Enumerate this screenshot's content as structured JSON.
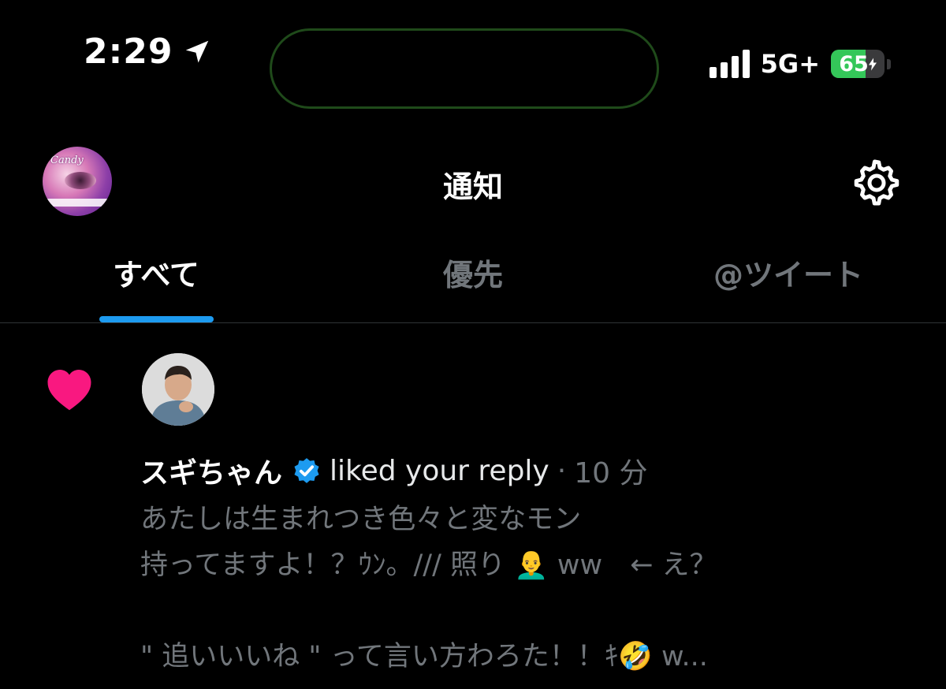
{
  "status_bar": {
    "time": "2:29",
    "network": "5G+",
    "battery_level": "65",
    "battery_fraction": 0.65
  },
  "header": {
    "title": "通知",
    "avatar_text": "Candy"
  },
  "tabs": [
    {
      "label": "すべて",
      "active": true
    },
    {
      "label": "優先",
      "active": false
    },
    {
      "label": "@ツイート",
      "active": false
    }
  ],
  "notification": {
    "user_name": "スギちゃん",
    "action": "liked your reply",
    "separator": "·",
    "time_ago": "10 分",
    "lines": [
      "あたしは生まれつき色々と変なモン",
      "持ってますよ！？ｳﾝ。/// 照り 👨‍🦲 ww　← え？",
      "",
      "\" 追いいいね \" って言い方わろた！！ｷ🤣 w..."
    ]
  },
  "colors": {
    "accent": "#1d9bf0",
    "heart": "#f91880",
    "battery": "#34c759",
    "muted_text": "#71767b"
  }
}
